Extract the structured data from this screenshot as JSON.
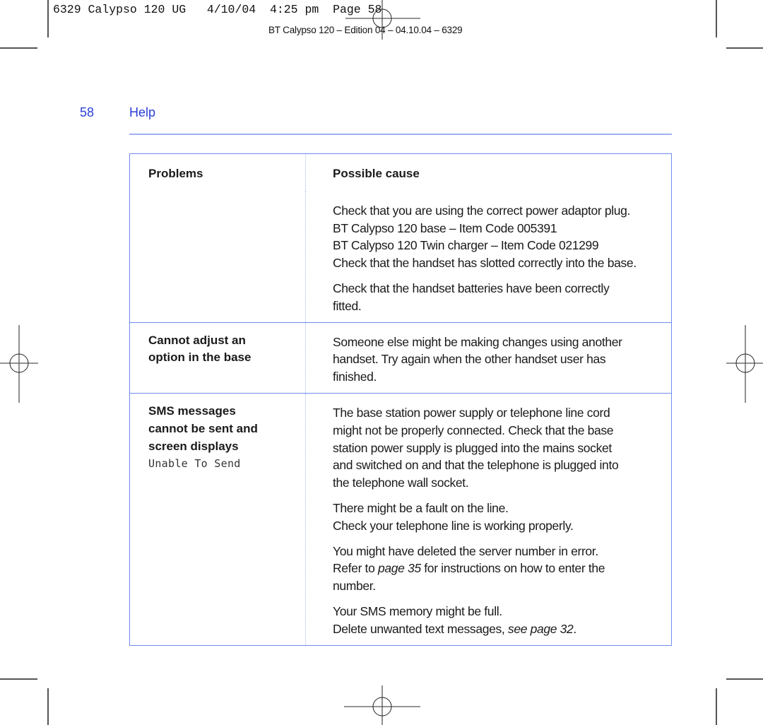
{
  "slug": {
    "text": "6329 Calypso 120 UG   4/10/04  4:25 pm  Page 58",
    "edition": "BT Calypso 120 – Edition 04 – 04.10.04 – 6329"
  },
  "header": {
    "page_number": "58",
    "section_title": "Help"
  },
  "table": {
    "headers": {
      "problems": "Problems",
      "cause": "Possible cause"
    },
    "rows": [
      {
        "problem": [],
        "problem_display": "",
        "causes": [
          {
            "lines": [
              "Check that you are using the correct power adaptor plug.",
              "BT Calypso 120 base – Item Code 005391",
              "BT Calypso 120 Twin charger – Item Code 021299",
              "Check that the handset has slotted correctly into the base."
            ]
          },
          {
            "lines": [
              "Check that the handset batteries have been correctly",
              "fitted."
            ]
          }
        ]
      },
      {
        "problem": [
          "Cannot adjust an",
          "option in the base"
        ],
        "problem_display": "",
        "causes": [
          {
            "lines": [
              "Someone else might be making changes using another",
              "handset. Try again when the other handset user has",
              "finished."
            ]
          }
        ]
      },
      {
        "problem": [
          "SMS messages",
          "cannot be sent and",
          "screen displays"
        ],
        "problem_display": "Unable To Send",
        "causes": [
          {
            "lines": [
              "The base station power supply or telephone line cord",
              "might not be properly connected. Check that the base",
              "station power supply is plugged into the mains socket",
              "and switched on and that the telephone is plugged into",
              "the telephone wall socket."
            ]
          },
          {
            "lines": [
              "There might be a fault on the line.",
              "Check your telephone line is working properly."
            ]
          },
          {
            "lines": [
              "You might have deleted the server number in error.",
              "Refer to |page 35| for instructions on how to enter the",
              "number."
            ]
          },
          {
            "lines": [
              "Your SMS memory might be full.",
              "Delete unwanted text messages, |see page 32|."
            ]
          }
        ]
      }
    ]
  },
  "colors": {
    "accent_blue": "#2a3fd6",
    "rule_blue": "#9fb0f2",
    "table_border": "#6f8cf0"
  }
}
